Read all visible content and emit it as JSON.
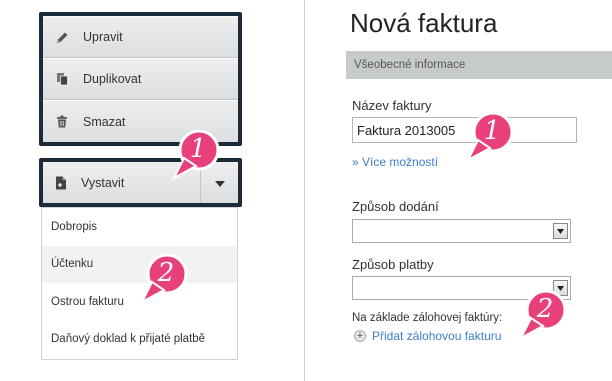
{
  "actions": {
    "items": [
      {
        "label": "Upravit",
        "icon": "pencil-icon"
      },
      {
        "label": "Duplikovat",
        "icon": "copy-icon"
      },
      {
        "label": "Smazat",
        "icon": "trash-icon"
      }
    ]
  },
  "issue": {
    "label": "Vystavit",
    "icon": "new-document-icon",
    "caret_icon": "caret-down-icon",
    "options": [
      "Dobropis",
      "Účtenku",
      "Ostrou fakturu",
      "Daňový doklad k přijaté platbě"
    ],
    "hovered_option": "Účtenku"
  },
  "form": {
    "title": "Nová faktura",
    "section": "Všeobecné informace",
    "invoice_name_label": "Název faktury",
    "invoice_name_value": "Faktura 2013005",
    "more_options": "» Více možností",
    "delivery_label": "Způsob dodání",
    "delivery_value": "",
    "payment_label": "Způsob platby",
    "payment_value": "",
    "deposit_label": "Na základe zálohovej faktúry:",
    "add_deposit": "Přidat zálohovou fakturu"
  },
  "callouts": {
    "color": "#e8407a",
    "labels": [
      "1",
      "1",
      "2",
      "2"
    ]
  },
  "colors": {
    "frame": "#1b2b3a",
    "link": "#3b7fc4",
    "section_bar": "#c7cacb"
  }
}
